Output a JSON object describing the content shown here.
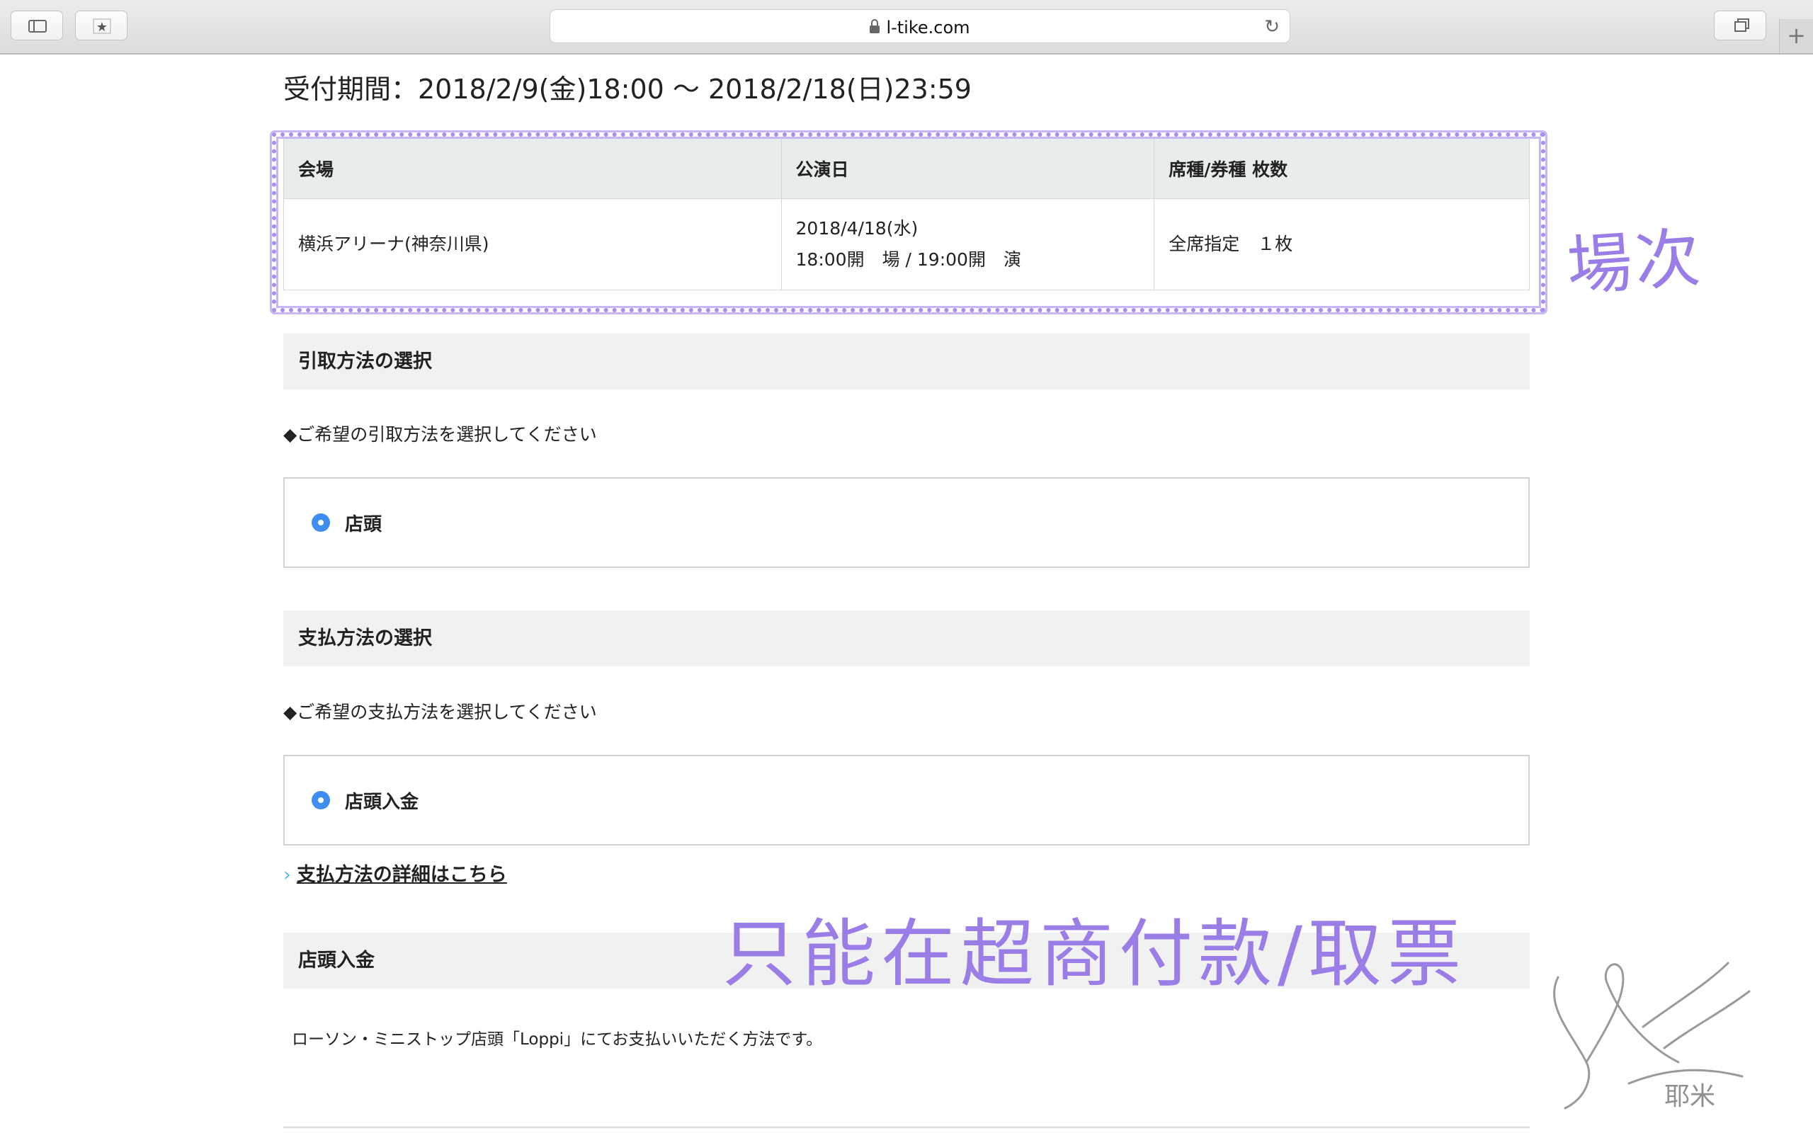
{
  "browser": {
    "url": "l-tike.com",
    "sidebar_icon": "sidebar-icon",
    "bookmarks_icon": "star-icon",
    "tabs_icon": "tab-overview-icon",
    "newtab_label": "+"
  },
  "reception": {
    "period": "受付期間：2018/2/9(金)18:00 〜 2018/2/18(日)23:59"
  },
  "venue_table": {
    "headers": [
      "会場",
      "公演日",
      "席種/券種 枚数"
    ],
    "venue": "横浜アリーナ(神奈川県)",
    "date": "2018/4/18(水)",
    "time": "18:00開　場 / 19:00開　演",
    "seat": "全席指定　１枚"
  },
  "pickup": {
    "heading": "引取方法の選択",
    "instruction": "◆ご希望の引取方法を選択してください",
    "option": "店頭"
  },
  "payment": {
    "heading": "支払方法の選択",
    "instruction": "◆ご希望の支払方法を選択してください",
    "option": "店頭入金",
    "detail_link": "支払方法の詳細はこちら"
  },
  "store_payment": {
    "heading": "店頭入金",
    "description": "ローソン・ミニストップ店頭「Loppi」にてお支払いいただく方法です。"
  },
  "annotations": {
    "venue_note": "場次",
    "payment_note": "只能在超商付款/取票",
    "signature": "耶米",
    "color": "#9a7de6"
  }
}
